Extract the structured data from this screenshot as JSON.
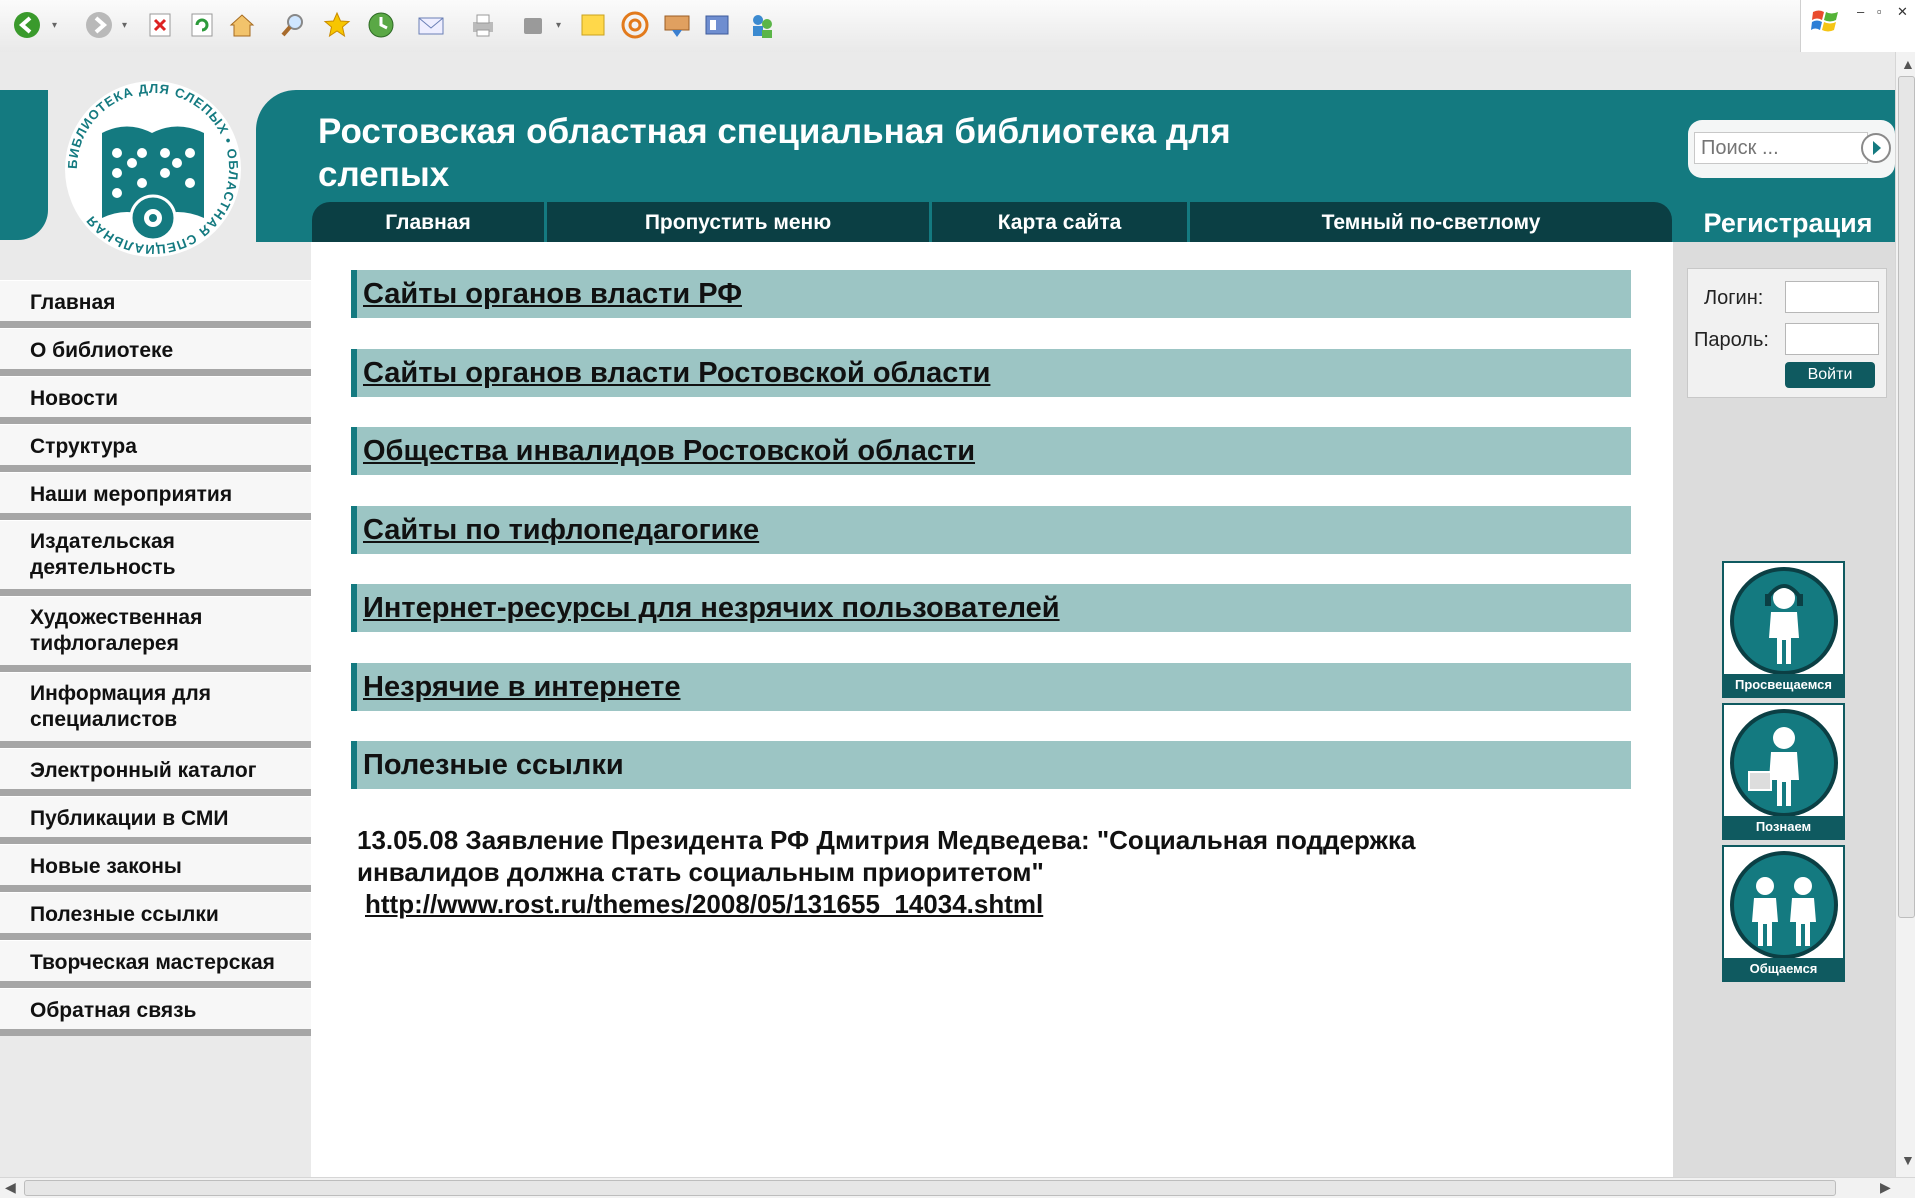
{
  "browser": {
    "toolbar_icons": [
      "back-icon",
      "forward-icon",
      "stop-icon",
      "refresh-icon",
      "home-icon",
      "search-icon",
      "favorites-icon",
      "history-icon",
      "mail-icon",
      "print-icon",
      "edit-icon",
      "notes-icon",
      "email-at-icon",
      "messenger-icon",
      "research-icon",
      "users-icon"
    ]
  },
  "header": {
    "title": "Ростовская областная специальная библиотека для слепых",
    "logo_text": "БИБЛИОТЕКА ДЛЯ СЛЕПЫХ • ОБЛАСТНАЯ СПЕЦИАЛЬНАЯ",
    "search_placeholder": "Поиск ...",
    "registration": "Регистрация"
  },
  "nav": [
    {
      "label": "Главная"
    },
    {
      "label": "Пропустить меню"
    },
    {
      "label": "Карта сайта"
    },
    {
      "label": "Темный по-светлому"
    }
  ],
  "sidebar": [
    "Главная",
    "О библиотеке",
    "Новости",
    "Структура",
    "Наши мероприятия",
    "Издательская деятельность",
    "Художественная тифлогалерея",
    "Информация для специалистов",
    "Электронный каталог",
    "Публикации в СМИ",
    "Новые законы",
    "Полезные ссылки",
    "Творческая мастерская",
    "Обратная связь"
  ],
  "categories": [
    {
      "label": "Сайты органов власти РФ",
      "link": true
    },
    {
      "label": "Сайты органов власти Ростовской области",
      "link": true
    },
    {
      "label": "Общества инвалидов Ростовской области",
      "link": true
    },
    {
      "label": "Сайты по тифлопедагогике",
      "link": true
    },
    {
      "label": "Интернет-ресурсы для незрячих пользователей",
      "link": true
    },
    {
      "label": "Незрячие в интернете",
      "link": true
    },
    {
      "label": "Полезные ссылки",
      "link": false
    }
  ],
  "news": {
    "text": "13.05.08 Заявление Президента РФ Дмитрия Медведева: \"Социальная поддержка инвалидов должна стать социальным приоритетом\"",
    "link": "http://www.rost.ru/themes/2008/05/131655_14034.shtml"
  },
  "login": {
    "login_label": "Логин:",
    "password_label": "Пароль:",
    "button": "Войти"
  },
  "badges": [
    "Просвещаемся",
    "Познаем",
    "Общаемся"
  ],
  "colors": {
    "header_teal": "#147a80",
    "nav_dark": "#0b3f44",
    "category_bg": "#9cc5c4"
  }
}
